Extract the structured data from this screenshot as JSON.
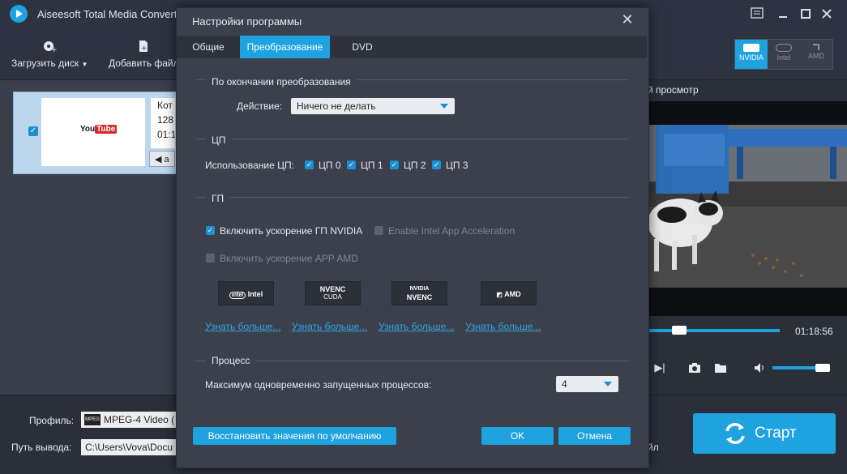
{
  "window": {
    "title": "Aiseesoft Total Media Convert"
  },
  "toolbar": {
    "load_disc": "Загрузить диск",
    "add_file": "Добавить файл"
  },
  "gpu_toggle": [
    "NVIDIA",
    "Intel",
    "AMD"
  ],
  "file_item": {
    "thumbnail_text": "YouTube",
    "info_lines": [
      "Кот",
      "128",
      "01:1"
    ],
    "audio": "a"
  },
  "preview": {
    "label": "й просмотр",
    "time": "01:18:56",
    "progress": 0.24,
    "volume": 0.8
  },
  "bottom": {
    "profile_label": "Профиль:",
    "profile_icon_text": "MPEG",
    "profile_value": "MPEG-4 Video (",
    "output_label": "Путь вывода:",
    "output_value": "C:\\Users\\Vova\\Docu",
    "merge_label": "йл",
    "start_label": "Старт"
  },
  "dialog": {
    "title": "Настройки программы",
    "close": "✕",
    "tabs": [
      {
        "label": "Общие",
        "active": false
      },
      {
        "label": "Преобразование",
        "active": true
      },
      {
        "label": "DVD",
        "active": false
      }
    ],
    "after_conversion": {
      "title": "По окончании преобразования",
      "action_label": "Действие:",
      "action_value": "Ничего не делать"
    },
    "cpu": {
      "title": "ЦП",
      "usage_label": "Использование ЦП:",
      "cores": [
        {
          "label": "ЦП 0",
          "checked": true
        },
        {
          "label": "ЦП 1",
          "checked": true
        },
        {
          "label": "ЦП 2",
          "checked": true
        },
        {
          "label": "ЦП 3",
          "checked": true
        }
      ]
    },
    "gpu": {
      "title": "ГП",
      "nvidia_label": "Включить ускорение ГП NVIDIA",
      "nvidia_checked": true,
      "intel_label": "Enable Intel App Acceleration",
      "intel_checked": false,
      "amd_label": "Включить ускорение APP AMD",
      "amd_checked": false,
      "logos": [
        {
          "line1": "intel",
          "line2": "Intel"
        },
        {
          "line1": "NVENC",
          "line2": "CUDA"
        },
        {
          "line1": "NVIDIA",
          "line2": "NVENC"
        },
        {
          "line1": "AMD",
          "line2": ""
        }
      ],
      "links": [
        "Узнать больше...",
        "Узнать больше...",
        "Узнать больше...",
        "Узнать больше..."
      ]
    },
    "process": {
      "title": "Процесс",
      "max_label": "Максимум одновременно запущенных процессов:",
      "max_value": "4"
    },
    "buttons": {
      "restore": "Восстановить значения по умолчанию",
      "ok": "OK",
      "cancel": "Отмена"
    }
  }
}
